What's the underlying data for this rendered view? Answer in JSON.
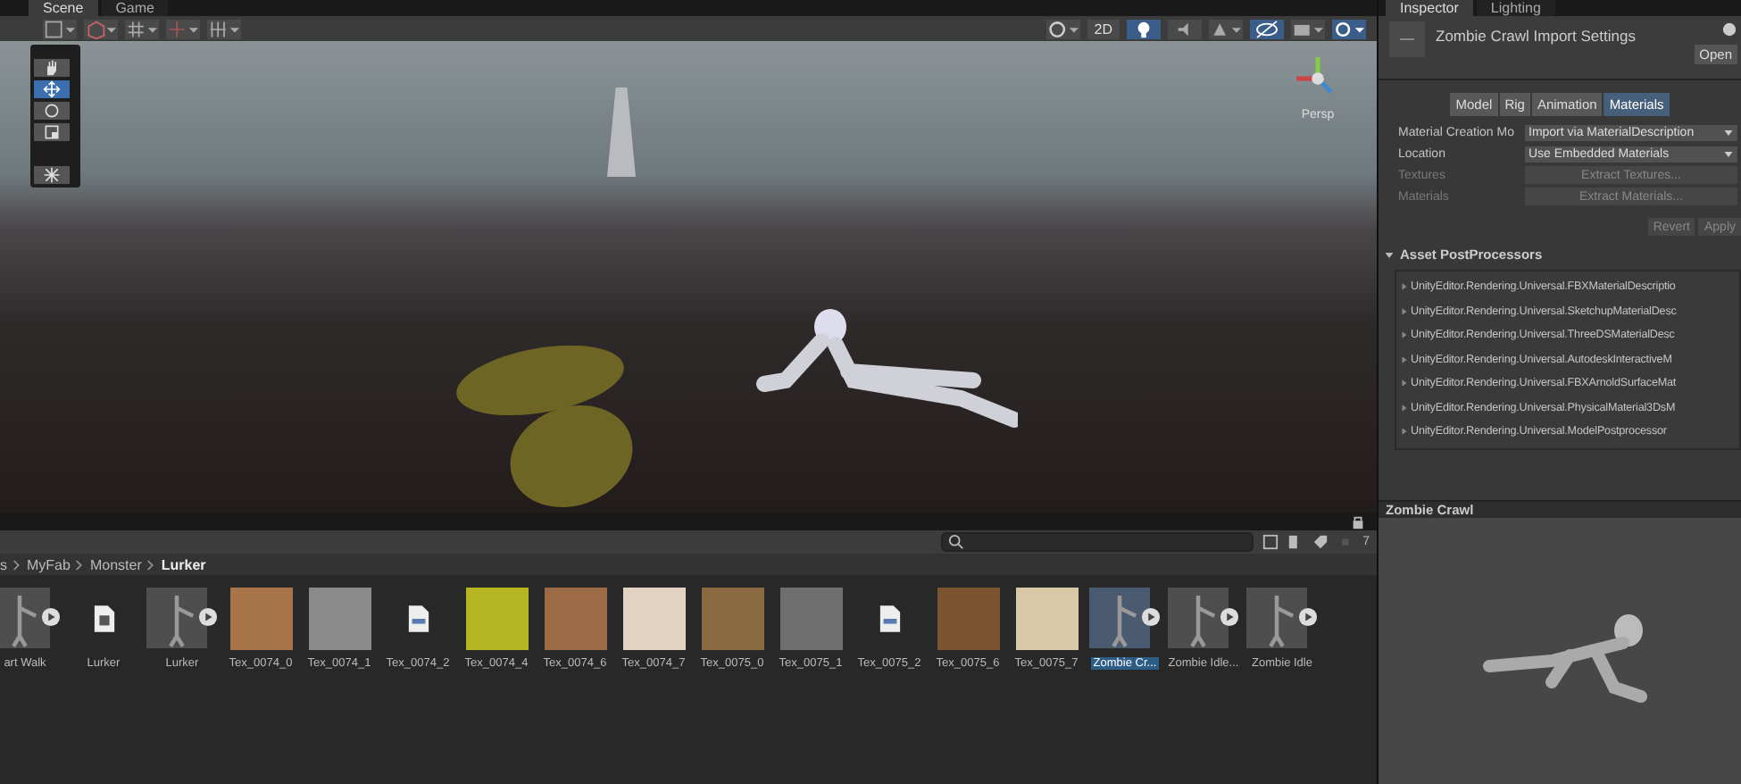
{
  "editor_tabs": [
    {
      "label": "Scene",
      "selected": true
    },
    {
      "label": "Game",
      "selected": false
    }
  ],
  "scene_toolbar": {
    "mode_2d": {
      "label": "2D",
      "on": false
    },
    "view_label": "Persp"
  },
  "inspector": {
    "tabs": [
      {
        "label": "Inspector",
        "selected": true
      },
      {
        "label": "Lighting",
        "selected": false
      }
    ],
    "title": "Zombie Crawl Import Settings",
    "open_button": "Open",
    "sections": [
      {
        "label": "Model",
        "selected": false
      },
      {
        "label": "Rig",
        "selected": false
      },
      {
        "label": "Animation",
        "selected": false
      },
      {
        "label": "Materials",
        "selected": true
      }
    ],
    "fields": [
      {
        "kind": "dropdown",
        "label": "Material Creation Mo",
        "value": "Import via MaterialDescription",
        "disabled": false
      },
      {
        "kind": "dropdown",
        "label": "Location",
        "value": "Use Embedded Materials",
        "disabled": false
      },
      {
        "kind": "button",
        "label": "Textures",
        "value": "Extract Textures...",
        "disabled": true
      },
      {
        "kind": "button",
        "label": "Materials",
        "value": "Extract Materials...",
        "disabled": true
      }
    ],
    "revert_button": {
      "label": "Revert",
      "disabled": true
    },
    "apply_button": {
      "label": "Apply",
      "disabled": true
    },
    "postprocessors": {
      "label": "Asset PostProcessors",
      "expanded": true,
      "items": [
        "UnityEditor.Rendering.Universal.FBXMaterialDescriptio",
        "UnityEditor.Rendering.Universal.SketchupMaterialDesc",
        "UnityEditor.Rendering.Universal.ThreeDSMaterialDesc",
        "UnityEditor.Rendering.Universal.AutodeskInteractiveM",
        "UnityEditor.Rendering.Universal.FBXArnoldSurfaceMat",
        "UnityEditor.Rendering.Universal.PhysicalMaterial3DsM",
        "UnityEditor.Rendering.Universal.ModelPostprocessor"
      ]
    },
    "preview_title": "Zombie Crawl"
  },
  "project": {
    "breadcrumb": [
      "s",
      "MyFab",
      "Monster",
      "Lurker"
    ],
    "visible_count": "7",
    "assets": [
      {
        "kind": "animation",
        "label": "art Walk",
        "selected": false
      },
      {
        "kind": "prefab",
        "label": "Lurker",
        "selected": false
      },
      {
        "kind": "animation",
        "label": "Lurker",
        "selected": false
      },
      {
        "kind": "texture",
        "label": "Tex_0074_0",
        "color": "#a8744a",
        "selected": false
      },
      {
        "kind": "texture",
        "label": "Tex_0074_1",
        "color": "#8a8a8a",
        "selected": false
      },
      {
        "kind": "file",
        "label": "Tex_0074_2",
        "selected": false
      },
      {
        "kind": "texture",
        "label": "Tex_0074_4",
        "color": "#b5b522",
        "selected": false
      },
      {
        "kind": "texture",
        "label": "Tex_0074_6",
        "color": "#9c6a45",
        "selected": false
      },
      {
        "kind": "texture",
        "label": "Tex_0074_7",
        "color": "#e2d2c2",
        "selected": false
      },
      {
        "kind": "texture",
        "label": "Tex_0075_0",
        "color": "#8a6a40",
        "selected": false
      },
      {
        "kind": "texture",
        "label": "Tex_0075_1",
        "color": "#6e6e6e",
        "selected": false
      },
      {
        "kind": "file",
        "label": "Tex_0075_2",
        "selected": false
      },
      {
        "kind": "texture",
        "label": "Tex_0075_6",
        "color": "#7a5530",
        "selected": false
      },
      {
        "kind": "texture",
        "label": "Tex_0075_7",
        "color": "#d8c8a8",
        "selected": false
      },
      {
        "kind": "animation",
        "label": "Zombie Cr...",
        "selected": true
      },
      {
        "kind": "animation",
        "label": "Zombie Idle...",
        "selected": false
      },
      {
        "kind": "animation",
        "label": "Zombie Idle",
        "selected": false
      }
    ]
  }
}
